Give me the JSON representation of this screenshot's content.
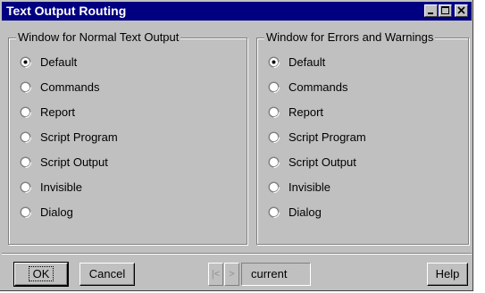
{
  "window": {
    "title": "Text Output Routing"
  },
  "normal_group": {
    "legend": "Window for Normal Text Output",
    "options": [
      "Default",
      "Commands",
      "Report",
      "Script Program",
      "Script Output",
      "Invisible",
      "Dialog"
    ],
    "selected": "Default"
  },
  "errors_group": {
    "legend": "Window for Errors and Warnings",
    "options": [
      "Default",
      "Commands",
      "Report",
      "Script Program",
      "Script Output",
      "Invisible",
      "Dialog"
    ],
    "selected": "Default"
  },
  "footer": {
    "ok_label": "OK",
    "cancel_label": "Cancel",
    "prev_glyph": "|<",
    "next_glyph": ">",
    "current_value": "current",
    "help_label": "Help"
  },
  "icons": [
    "minimize-icon",
    "maximize-icon",
    "close-icon",
    "radio-icon"
  ],
  "colors": {
    "titlebar": "#000080",
    "face": "#c0c0c0",
    "shadow": "#808080",
    "highlight": "#ffffff"
  }
}
